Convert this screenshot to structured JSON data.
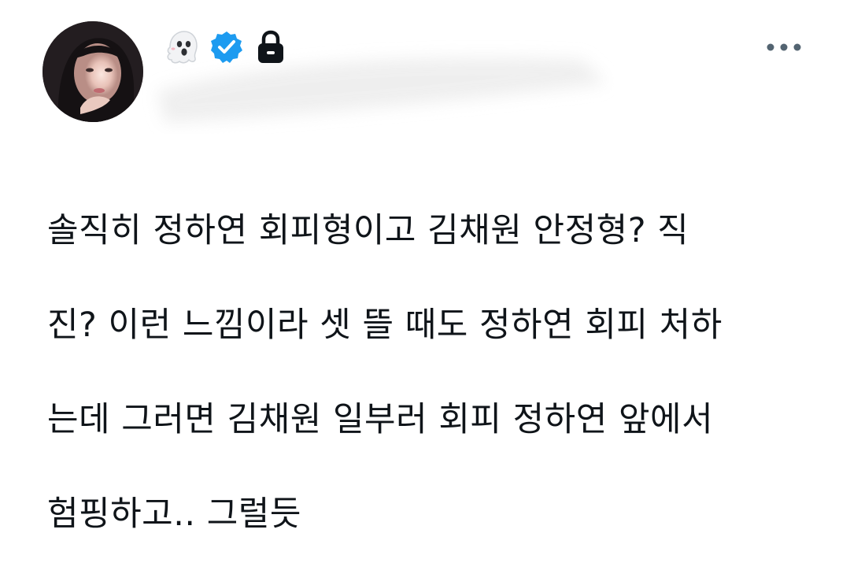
{
  "tweet": {
    "text_lines": [
      "솔직히 정하연 회피형이고 김채원 안정형? 직",
      "진? 이런 느낌이라 셋 뜰 때도 정하연 회피 처하",
      "는데 그러면 김채원 일부러 회피 정하연 앞에서",
      "험핑하고.. 그럴듯"
    ]
  },
  "header": {
    "badges": [
      {
        "icon": "ghost-emoji-icon"
      },
      {
        "icon": "verified-badge-icon",
        "color": "#1d9bf0"
      },
      {
        "icon": "lock-icon",
        "color": "#0f1419"
      }
    ],
    "more_icon": "more-options-icon"
  },
  "colors": {
    "text": "#0f1419",
    "verified": "#1d9bf0",
    "muted": "#536471",
    "background": "#ffffff"
  }
}
